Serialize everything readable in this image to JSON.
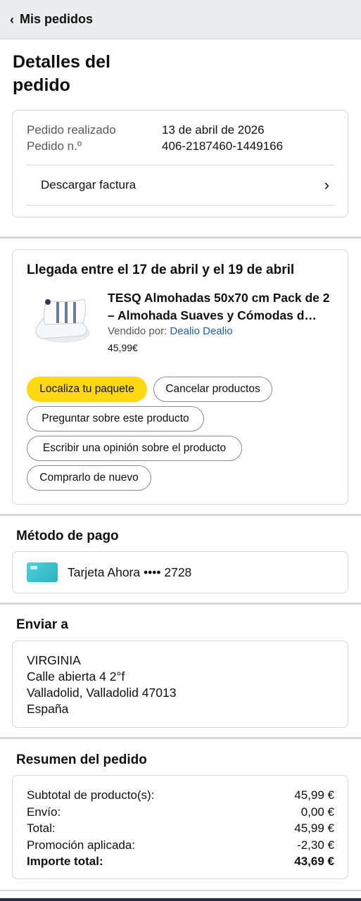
{
  "topbar": {
    "back_label": "Mis pedidos"
  },
  "page_title": "Detalles del pedido",
  "order_info": {
    "placed_label": "Pedido realizado",
    "placed_value": "13 de abril de 2026",
    "number_label": "Pedido n.º",
    "number_value": "406-2187460-1449166",
    "invoice_label": "Descargar factura"
  },
  "shipment": {
    "arrival": "Llegada entre el 17 de abril y el 19 de abril",
    "product_title": "TESQ Almohadas 50x70 cm Pack de 2 – Almohada Suaves y Cómodas d…",
    "seller_label": "Vendido por:",
    "seller_name": "Dealio Dealio",
    "price": "45,99€",
    "buttons": {
      "track": "Localiza tu paquete",
      "cancel": "Cancelar productos",
      "ask": "Preguntar sobre este producto",
      "review": "Escribir una opinión sobre el producto",
      "buy_again": "Comprarlo de nuevo"
    }
  },
  "payment": {
    "title": "Método de pago",
    "card_text": "Tarjeta Ahora •••• 2728",
    "icon": "credit-card-icon",
    "card_color": "#3cc3cd"
  },
  "shipping": {
    "title": "Enviar a",
    "lines": [
      "VIRGINIA",
      "Calle abierta 4 2°f",
      "Valladolid, Valladolid 47013",
      "España"
    ]
  },
  "summary": {
    "title": "Resumen del pedido",
    "rows": [
      {
        "label": "Subtotal de producto(s):",
        "value": "45,99 €"
      },
      {
        "label": "Envío:",
        "value": "0,00 €"
      },
      {
        "label": "Total:",
        "value": "45,99 €"
      },
      {
        "label": "Promoción aplicada:",
        "value": "-2,30 €"
      },
      {
        "label": "Importe total:",
        "value": "43,69 €"
      }
    ]
  },
  "colors": {
    "accent_button": "#ffd814",
    "link": "#2162a1",
    "topbar": "#eaeded"
  }
}
